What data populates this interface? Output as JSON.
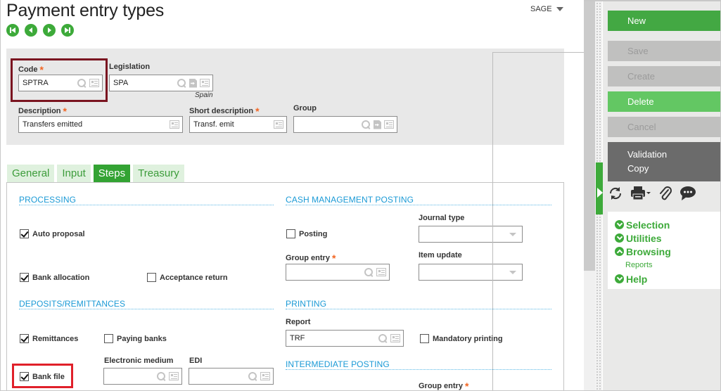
{
  "page": {
    "title": "Payment entry types",
    "folder": "SAGE"
  },
  "nav": {
    "first": "first-record",
    "previous": "previous-record",
    "next": "next-record",
    "last": "last-record"
  },
  "header": {
    "code": {
      "label": "Code",
      "value": "SPTRA",
      "required": true
    },
    "legislation": {
      "label": "Legislation",
      "value": "SPA",
      "caption": "Spain"
    },
    "description": {
      "label": "Description",
      "value": "Transfers emitted",
      "required": true
    },
    "short_description": {
      "label": "Short description",
      "value": "Transf. emit",
      "required": true
    },
    "group": {
      "label": "Group",
      "value": ""
    },
    "required_marker": "*"
  },
  "tabs": [
    {
      "label": "General",
      "active": false
    },
    {
      "label": "Input",
      "active": false
    },
    {
      "label": "Steps",
      "active": true
    },
    {
      "label": "Treasury",
      "active": false
    }
  ],
  "steps": {
    "processing": {
      "title": "PROCESSING",
      "auto_proposal": {
        "label": "Auto proposal",
        "checked": true
      },
      "bank_allocation": {
        "label": "Bank allocation",
        "checked": true
      },
      "acceptance_return": {
        "label": "Acceptance return",
        "checked": false
      }
    },
    "cash_management_posting": {
      "title": "CASH MANAGEMENT POSTING",
      "posting": {
        "label": "Posting",
        "checked": false
      },
      "journal_type": {
        "label": "Journal type",
        "value": ""
      },
      "group_entry": {
        "label": "Group entry",
        "value": "",
        "required": true
      },
      "item_update": {
        "label": "Item update",
        "value": ""
      }
    },
    "deposits_remittances": {
      "title": "DEPOSITS/REMITTANCES",
      "remittances": {
        "label": "Remittances",
        "checked": true
      },
      "paying_banks": {
        "label": "Paying banks",
        "checked": false
      },
      "bank_file": {
        "label": "Bank file",
        "checked": true
      },
      "electronic_medium": {
        "label": "Electronic medium",
        "value": ""
      },
      "edi": {
        "label": "EDI",
        "value": ""
      }
    },
    "printing": {
      "title": "PRINTING",
      "report": {
        "label": "Report",
        "value": "TRF"
      },
      "mandatory_printing": {
        "label": "Mandatory printing",
        "checked": false
      }
    },
    "intermediate_posting": {
      "title": "INTERMEDIATE POSTING",
      "group_entry": {
        "label": "Group entry",
        "required": true
      }
    }
  },
  "actions": {
    "new": "New",
    "save": "Save",
    "create": "Create",
    "delete": "Delete",
    "cancel": "Cancel",
    "validation_copy_line1": "Validation",
    "validation_copy_line2": "Copy"
  },
  "toolbar": {
    "refresh": "refresh-icon",
    "print": "printer-icon",
    "attach": "paperclip-icon",
    "comment": "comment-icon"
  },
  "menu": {
    "selection": "Selection",
    "utilities": "Utilities",
    "browsing": "Browsing",
    "reports": "Reports",
    "help": "Help"
  },
  "colors": {
    "accent_green": "#3daa3a",
    "section_blue": "#1b9ad6",
    "required_orange": "#f26522",
    "code_highlight": "#7a1420",
    "bankfile_highlight": "#e0202a"
  }
}
